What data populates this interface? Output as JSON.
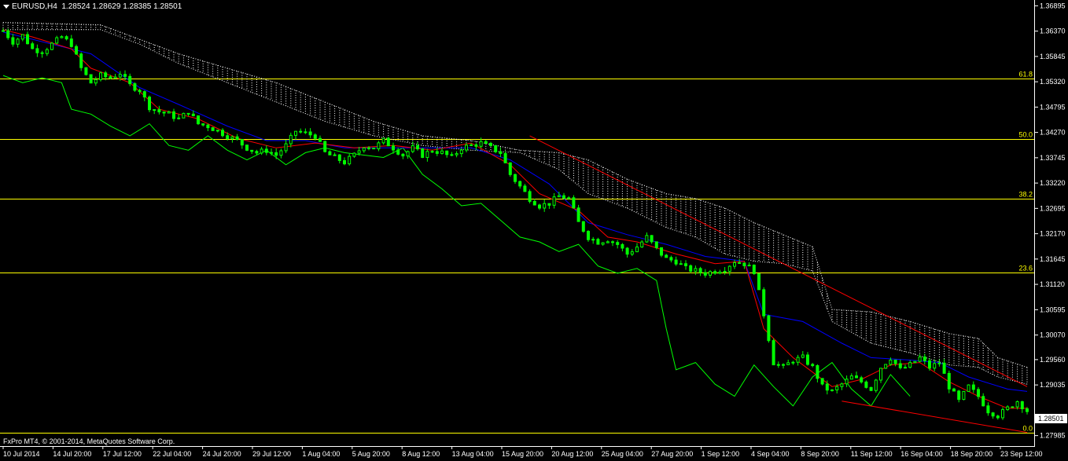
{
  "header": {
    "symbol": "EURUSD,H4",
    "ohlc": "1.28524 1.28629 1.28385 1.28501"
  },
  "footer": {
    "copyright": "FxPro MT4, © 2001-2014, MetaQuotes Software Corp."
  },
  "price_axis": {
    "ticks": [
      "1.36895",
      "1.36370",
      "1.35845",
      "1.35320",
      "1.34795",
      "1.34270",
      "1.33745",
      "1.33220",
      "1.32695",
      "1.32170",
      "1.31645",
      "1.31120",
      "1.30595",
      "1.30070",
      "1.29560",
      "1.29035",
      "1.27985"
    ],
    "current_price": "1.28501"
  },
  "time_axis": {
    "ticks": [
      "10 Jul 2014",
      "14 Jul 20:00",
      "17 Jul 12:00",
      "22 Jul 04:00",
      "24 Jul 20:00",
      "29 Jul 12:00",
      "1 Aug 04:00",
      "5 Aug 20:00",
      "8 Aug 12:00",
      "13 Aug 04:00",
      "15 Aug 20:00",
      "20 Aug 12:00",
      "25 Aug 04:00",
      "27 Aug 20:00",
      "1 Sep 12:00",
      "4 Sep 04:00",
      "8 Sep 20:00",
      "11 Sep 12:00",
      "16 Sep 04:00",
      "18 Sep 20:00",
      "23 Sep 12:00"
    ]
  },
  "fibonacci": {
    "color": "#ffff00",
    "levels": [
      {
        "label": "61.8",
        "price": 1.3538
      },
      {
        "label": "50.0",
        "price": 1.3414
      },
      {
        "label": "38.2",
        "price": 1.329
      },
      {
        "label": "23.6",
        "price": 1.3137
      },
      {
        "label": "0.0",
        "price": 1.2804
      }
    ]
  },
  "colors": {
    "background": "#000000",
    "candle": "#00ff00",
    "tenkan": "#ff0000",
    "kijun": "#0000ff",
    "chikou": "#00ff00",
    "cloud": "#ffffff",
    "trendline": "#ff0000",
    "axis_text": "#ffffff"
  },
  "chart_data": {
    "type": "candlestick",
    "title": "EURUSD,H4",
    "ylim": [
      1.278,
      1.3695
    ],
    "indicators": [
      "Ichimoku Kinko Hyo",
      "Fibonacci retracement",
      "Trendlines"
    ],
    "close_path": [
      [
        0,
        1.3638
      ],
      [
        2,
        1.3615
      ],
      [
        4,
        1.3628
      ],
      [
        6,
        1.36
      ],
      [
        8,
        1.3595
      ],
      [
        10,
        1.361
      ],
      [
        12,
        1.3625
      ],
      [
        14,
        1.361
      ],
      [
        16,
        1.356
      ],
      [
        18,
        1.353
      ],
      [
        20,
        1.3545
      ],
      [
        22,
        1.354
      ],
      [
        24,
        1.355
      ],
      [
        26,
        1.3525
      ],
      [
        28,
        1.3515
      ],
      [
        30,
        1.348
      ],
      [
        32,
        1.347
      ],
      [
        34,
        1.3465
      ],
      [
        36,
        1.3455
      ],
      [
        38,
        1.347
      ],
      [
        40,
        1.3445
      ],
      [
        42,
        1.344
      ],
      [
        44,
        1.343
      ],
      [
        46,
        1.342
      ],
      [
        48,
        1.341
      ],
      [
        50,
        1.3395
      ],
      [
        52,
        1.3385
      ],
      [
        54,
        1.339
      ],
      [
        56,
        1.338
      ],
      [
        58,
        1.34
      ],
      [
        60,
        1.343
      ],
      [
        62,
        1.3425
      ],
      [
        64,
        1.342
      ],
      [
        66,
        1.3385
      ],
      [
        68,
        1.3375
      ],
      [
        70,
        1.3365
      ],
      [
        72,
        1.338
      ],
      [
        74,
        1.34
      ],
      [
        76,
        1.3395
      ],
      [
        78,
        1.341
      ],
      [
        80,
        1.3395
      ],
      [
        82,
        1.338
      ],
      [
        84,
        1.3395
      ],
      [
        86,
        1.338
      ],
      [
        88,
        1.339
      ],
      [
        90,
        1.3385
      ],
      [
        92,
        1.3375
      ],
      [
        94,
        1.3395
      ],
      [
        96,
        1.34
      ],
      [
        98,
        1.3405
      ],
      [
        100,
        1.3395
      ],
      [
        102,
        1.3385
      ],
      [
        104,
        1.334
      ],
      [
        106,
        1.3315
      ],
      [
        108,
        1.329
      ],
      [
        110,
        1.3275
      ],
      [
        112,
        1.328
      ],
      [
        114,
        1.3295
      ],
      [
        116,
        1.329
      ],
      [
        118,
        1.324
      ],
      [
        120,
        1.321
      ],
      [
        122,
        1.32
      ],
      [
        124,
        1.3205
      ],
      [
        126,
        1.3195
      ],
      [
        128,
        1.3175
      ],
      [
        130,
        1.319
      ],
      [
        132,
        1.321
      ],
      [
        134,
        1.3185
      ],
      [
        136,
        1.3165
      ],
      [
        138,
        1.316
      ],
      [
        140,
        1.3145
      ],
      [
        142,
        1.314
      ],
      [
        144,
        1.3135
      ],
      [
        146,
        1.314
      ],
      [
        148,
        1.3145
      ],
      [
        150,
        1.316
      ],
      [
        152,
        1.3155
      ],
      [
        154,
        1.314
      ],
      [
        156,
        1.305
      ],
      [
        158,
        1.295
      ],
      [
        160,
        1.294
      ],
      [
        162,
        1.2955
      ],
      [
        164,
        1.296
      ],
      [
        166,
        1.294
      ],
      [
        168,
        1.29
      ],
      [
        170,
        1.289
      ],
      [
        172,
        1.2905
      ],
      [
        174,
        1.292
      ],
      [
        176,
        1.291
      ],
      [
        178,
        1.2895
      ],
      [
        180,
        1.294
      ],
      [
        182,
        1.296
      ],
      [
        184,
        1.2935
      ],
      [
        186,
        1.2945
      ],
      [
        188,
        1.296
      ],
      [
        190,
        1.294
      ],
      [
        192,
        1.295
      ],
      [
        194,
        1.29
      ],
      [
        196,
        1.287
      ],
      [
        198,
        1.29
      ],
      [
        200,
        1.288
      ],
      [
        202,
        1.285
      ],
      [
        204,
        1.284
      ],
      [
        206,
        1.2855
      ],
      [
        208,
        1.287
      ],
      [
        210,
        1.285
      ]
    ],
    "tenkan_path": [
      [
        0,
        1.364
      ],
      [
        6,
        1.3625
      ],
      [
        14,
        1.36
      ],
      [
        18,
        1.356
      ],
      [
        26,
        1.353
      ],
      [
        32,
        1.3475
      ],
      [
        40,
        1.3455
      ],
      [
        48,
        1.3415
      ],
      [
        56,
        1.3395
      ],
      [
        64,
        1.3405
      ],
      [
        72,
        1.3395
      ],
      [
        80,
        1.34
      ],
      [
        88,
        1.339
      ],
      [
        96,
        1.3405
      ],
      [
        104,
        1.336
      ],
      [
        110,
        1.33
      ],
      [
        118,
        1.3265
      ],
      [
        124,
        1.321
      ],
      [
        130,
        1.32
      ],
      [
        138,
        1.3175
      ],
      [
        146,
        1.3155
      ],
      [
        152,
        1.316
      ],
      [
        156,
        1.302
      ],
      [
        162,
        1.296
      ],
      [
        170,
        1.29
      ],
      [
        176,
        1.2915
      ],
      [
        182,
        1.2945
      ],
      [
        188,
        1.295
      ],
      [
        194,
        1.291
      ],
      [
        200,
        1.288
      ],
      [
        206,
        1.2855
      ],
      [
        210,
        1.2855
      ]
    ],
    "kijun_path": [
      [
        0,
        1.3635
      ],
      [
        10,
        1.361
      ],
      [
        18,
        1.359
      ],
      [
        28,
        1.352
      ],
      [
        36,
        1.3485
      ],
      [
        46,
        1.344
      ],
      [
        54,
        1.341
      ],
      [
        62,
        1.341
      ],
      [
        70,
        1.3395
      ],
      [
        78,
        1.3395
      ],
      [
        86,
        1.3395
      ],
      [
        96,
        1.3395
      ],
      [
        104,
        1.337
      ],
      [
        112,
        1.332
      ],
      [
        120,
        1.324
      ],
      [
        128,
        1.3215
      ],
      [
        136,
        1.3195
      ],
      [
        144,
        1.317
      ],
      [
        152,
        1.316
      ],
      [
        156,
        1.305
      ],
      [
        164,
        1.3035
      ],
      [
        172,
        1.299
      ],
      [
        178,
        1.296
      ],
      [
        186,
        1.2955
      ],
      [
        192,
        1.295
      ],
      [
        198,
        1.292
      ],
      [
        206,
        1.2895
      ],
      [
        210,
        1.289
      ]
    ],
    "chikou_path": [
      [
        0,
        1.3545
      ],
      [
        4,
        1.353
      ],
      [
        8,
        1.354
      ],
      [
        12,
        1.353
      ],
      [
        14,
        1.3475
      ],
      [
        18,
        1.3465
      ],
      [
        22,
        1.344
      ],
      [
        26,
        1.342
      ],
      [
        30,
        1.3445
      ],
      [
        34,
        1.34
      ],
      [
        38,
        1.339
      ],
      [
        42,
        1.342
      ],
      [
        46,
        1.339
      ],
      [
        50,
        1.337
      ],
      [
        54,
        1.339
      ],
      [
        58,
        1.336
      ],
      [
        62,
        1.3385
      ],
      [
        66,
        1.3395
      ],
      [
        70,
        1.3385
      ],
      [
        74,
        1.338
      ],
      [
        78,
        1.3375
      ],
      [
        82,
        1.3395
      ],
      [
        86,
        1.334
      ],
      [
        90,
        1.331
      ],
      [
        94,
        1.3275
      ],
      [
        98,
        1.328
      ],
      [
        102,
        1.3245
      ],
      [
        106,
        1.321
      ],
      [
        110,
        1.32
      ],
      [
        114,
        1.318
      ],
      [
        118,
        1.3195
      ],
      [
        122,
        1.315
      ],
      [
        126,
        1.3135
      ],
      [
        130,
        1.3145
      ],
      [
        134,
        1.312
      ],
      [
        136,
        1.302
      ],
      [
        138,
        1.2935
      ],
      [
        142,
        1.295
      ],
      [
        146,
        1.2905
      ],
      [
        150,
        1.288
      ],
      [
        154,
        1.2945
      ],
      [
        158,
        1.29
      ],
      [
        162,
        1.286
      ],
      [
        166,
        1.292
      ],
      [
        170,
        1.295
      ],
      [
        174,
        1.2895
      ],
      [
        178,
        1.286
      ],
      [
        182,
        1.2925
      ],
      [
        186,
        1.288
      ]
    ],
    "cloud_upper": [
      [
        0,
        1.3655
      ],
      [
        20,
        1.365
      ],
      [
        28,
        1.362
      ],
      [
        36,
        1.359
      ],
      [
        46,
        1.356
      ],
      [
        56,
        1.353
      ],
      [
        66,
        1.349
      ],
      [
        76,
        1.345
      ],
      [
        86,
        1.342
      ],
      [
        96,
        1.341
      ],
      [
        106,
        1.339
      ],
      [
        114,
        1.3385
      ],
      [
        120,
        1.337
      ],
      [
        128,
        1.333
      ],
      [
        136,
        1.33
      ],
      [
        142,
        1.329
      ],
      [
        148,
        1.327
      ],
      [
        154,
        1.324
      ],
      [
        160,
        1.3215
      ],
      [
        166,
        1.319
      ],
      [
        170,
        1.306
      ],
      [
        178,
        1.3055
      ],
      [
        186,
        1.3035
      ],
      [
        194,
        1.301
      ],
      [
        200,
        1.3
      ],
      [
        204,
        1.296
      ],
      [
        210,
        1.294
      ]
    ],
    "cloud_lower": [
      [
        0,
        1.364
      ],
      [
        20,
        1.364
      ],
      [
        28,
        1.361
      ],
      [
        36,
        1.357
      ],
      [
        46,
        1.353
      ],
      [
        56,
        1.349
      ],
      [
        66,
        1.345
      ],
      [
        76,
        1.342
      ],
      [
        86,
        1.34
      ],
      [
        96,
        1.339
      ],
      [
        106,
        1.3385
      ],
      [
        114,
        1.335
      ],
      [
        120,
        1.33
      ],
      [
        128,
        1.327
      ],
      [
        136,
        1.323
      ],
      [
        142,
        1.321
      ],
      [
        148,
        1.3175
      ],
      [
        154,
        1.316
      ],
      [
        160,
        1.3155
      ],
      [
        166,
        1.314
      ],
      [
        170,
        1.3035
      ],
      [
        178,
        1.299
      ],
      [
        186,
        1.297
      ],
      [
        194,
        1.2945
      ],
      [
        200,
        1.294
      ],
      [
        204,
        1.292
      ],
      [
        210,
        1.2905
      ]
    ],
    "trendlines": [
      {
        "from": [
          108,
          1.342
        ],
        "to": [
          210,
          1.29
        ]
      },
      {
        "from": [
          172,
          1.287
        ],
        "to": [
          210,
          1.2805
        ]
      }
    ],
    "bar_count": 211
  }
}
